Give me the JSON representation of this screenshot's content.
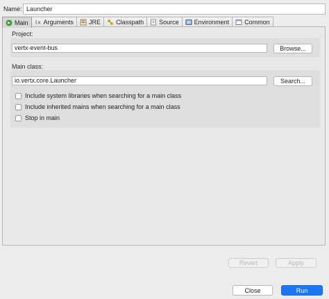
{
  "name": {
    "label": "Name:",
    "value": "Launcher"
  },
  "tabs": [
    {
      "label": "Main",
      "icon": "main-tab-icon",
      "active": true
    },
    {
      "label": "Arguments",
      "icon": "arguments-icon"
    },
    {
      "label": "JRE",
      "icon": "jre-icon"
    },
    {
      "label": "Classpath",
      "icon": "classpath-icon"
    },
    {
      "label": "Source",
      "icon": "source-icon"
    },
    {
      "label": "Environment",
      "icon": "environment-icon"
    },
    {
      "label": "Common",
      "icon": "common-icon"
    }
  ],
  "project": {
    "label": "Project:",
    "value": "vertx-event-bus",
    "button": "Browse..."
  },
  "main_class": {
    "label": "Main class:",
    "value": "io.vertx.core.Launcher",
    "button": "Search...",
    "options": [
      {
        "label": "Include system libraries when searching for a main class",
        "checked": false
      },
      {
        "label": "Include inherited mains when searching for a main class",
        "checked": false
      },
      {
        "label": "Stop in main",
        "checked": false
      }
    ]
  },
  "actions": {
    "revert": "Revert",
    "apply": "Apply"
  },
  "footer": {
    "close": "Close",
    "run": "Run"
  },
  "colors": {
    "accent": "#1b77f3",
    "panel": "#e8e8e8",
    "group": "#dedede"
  }
}
